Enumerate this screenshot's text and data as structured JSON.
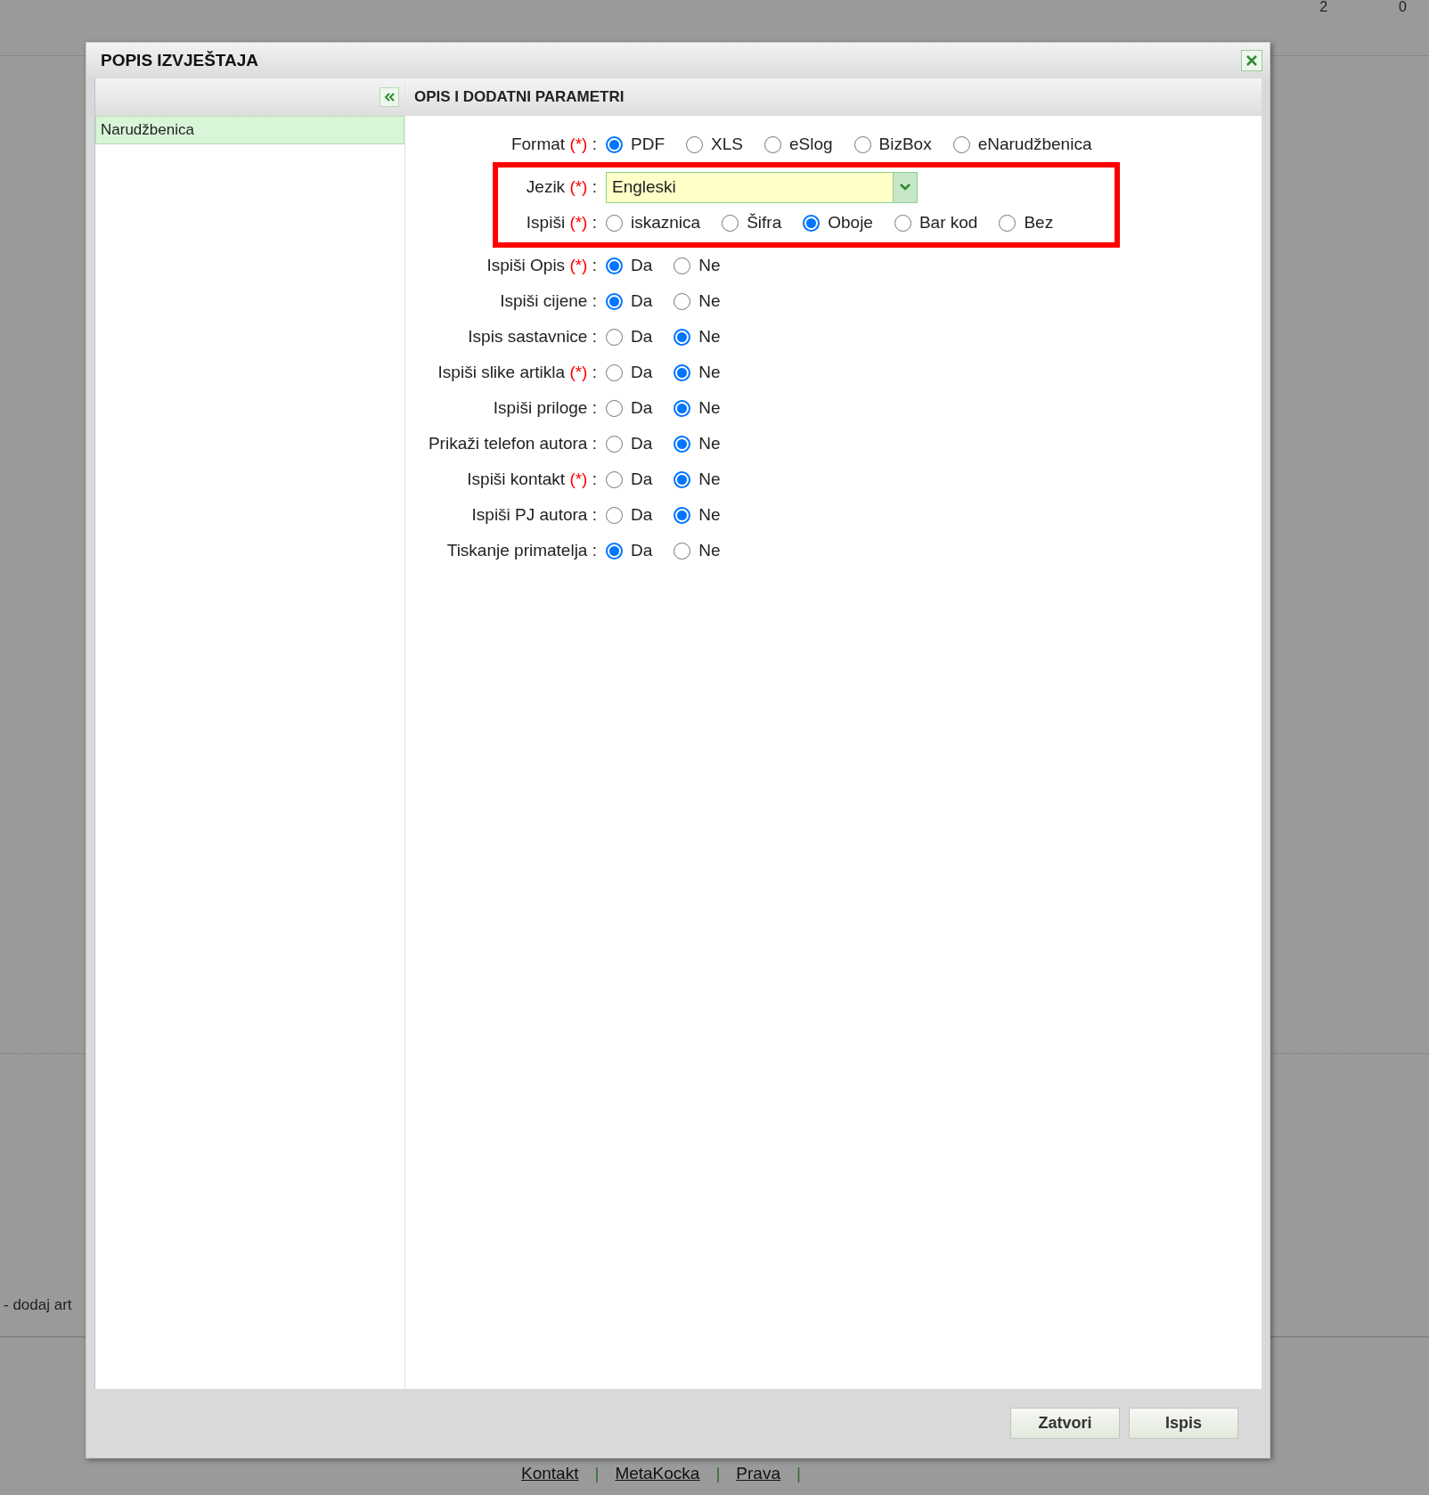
{
  "background": {
    "corner_values": [
      "2",
      "0"
    ],
    "row_text": "- dodaj art",
    "footer_links": [
      "Kontakt",
      "MetaKocka",
      "Prava"
    ],
    "footer_separator": "|"
  },
  "dialog": {
    "title": "POPIS IZVJEŠTAJA",
    "report_list": [
      {
        "label": "Narudžbenica",
        "selected": true
      }
    ],
    "panel_title": "OPIS I DODATNI PARAMETRI",
    "label_separator": ":",
    "fields": [
      {
        "kind": "radio",
        "label": "Format",
        "required_mark": "(*)",
        "highlighted": false,
        "options": [
          {
            "label": "PDF",
            "selected": true
          },
          {
            "label": "XLS",
            "selected": false
          },
          {
            "label": "eSlog",
            "selected": false
          },
          {
            "label": "BizBox",
            "selected": false
          },
          {
            "label": "eNarudžbenica",
            "selected": false
          }
        ]
      },
      {
        "kind": "select",
        "label": "Jezik",
        "required_mark": "(*)",
        "highlighted": true,
        "value": "Engleski"
      },
      {
        "kind": "radio",
        "label": "Ispiši",
        "required_mark": "(*)",
        "highlighted": true,
        "options": [
          {
            "label": "iskaznica",
            "selected": false
          },
          {
            "label": "Šifra",
            "selected": false
          },
          {
            "label": "Oboje",
            "selected": true
          },
          {
            "label": "Bar kod",
            "selected": false
          },
          {
            "label": "Bez",
            "selected": false
          }
        ]
      },
      {
        "kind": "radio",
        "label": "Ispiši Opis",
        "required_mark": "(*)",
        "highlighted": false,
        "options": [
          {
            "label": "Da",
            "selected": true
          },
          {
            "label": "Ne",
            "selected": false
          }
        ]
      },
      {
        "kind": "radio",
        "label": "Ispiši cijene",
        "highlighted": false,
        "options": [
          {
            "label": "Da",
            "selected": true
          },
          {
            "label": "Ne",
            "selected": false
          }
        ]
      },
      {
        "kind": "radio",
        "label": "Ispis sastavnice",
        "highlighted": false,
        "options": [
          {
            "label": "Da",
            "selected": false
          },
          {
            "label": "Ne",
            "selected": true
          }
        ]
      },
      {
        "kind": "radio",
        "label": "Ispiši slike artikla",
        "required_mark": "(*)",
        "highlighted": false,
        "options": [
          {
            "label": "Da",
            "selected": false
          },
          {
            "label": "Ne",
            "selected": true
          }
        ]
      },
      {
        "kind": "radio",
        "label": "Ispiši priloge",
        "highlighted": false,
        "options": [
          {
            "label": "Da",
            "selected": false
          },
          {
            "label": "Ne",
            "selected": true
          }
        ]
      },
      {
        "kind": "radio",
        "label": "Prikaži telefon autora",
        "highlighted": false,
        "options": [
          {
            "label": "Da",
            "selected": false
          },
          {
            "label": "Ne",
            "selected": true
          }
        ]
      },
      {
        "kind": "radio",
        "label": "Ispiši kontakt",
        "required_mark": "(*)",
        "highlighted": false,
        "options": [
          {
            "label": "Da",
            "selected": false
          },
          {
            "label": "Ne",
            "selected": true
          }
        ]
      },
      {
        "kind": "radio",
        "label": "Ispiši PJ autora",
        "highlighted": false,
        "options": [
          {
            "label": "Da",
            "selected": false
          },
          {
            "label": "Ne",
            "selected": true
          }
        ]
      },
      {
        "kind": "radio",
        "label": "Tiskanje primatelja",
        "highlighted": false,
        "options": [
          {
            "label": "Da",
            "selected": true
          },
          {
            "label": "Ne",
            "selected": false
          }
        ]
      }
    ],
    "buttons": [
      "Zatvori",
      "Ispis"
    ]
  }
}
